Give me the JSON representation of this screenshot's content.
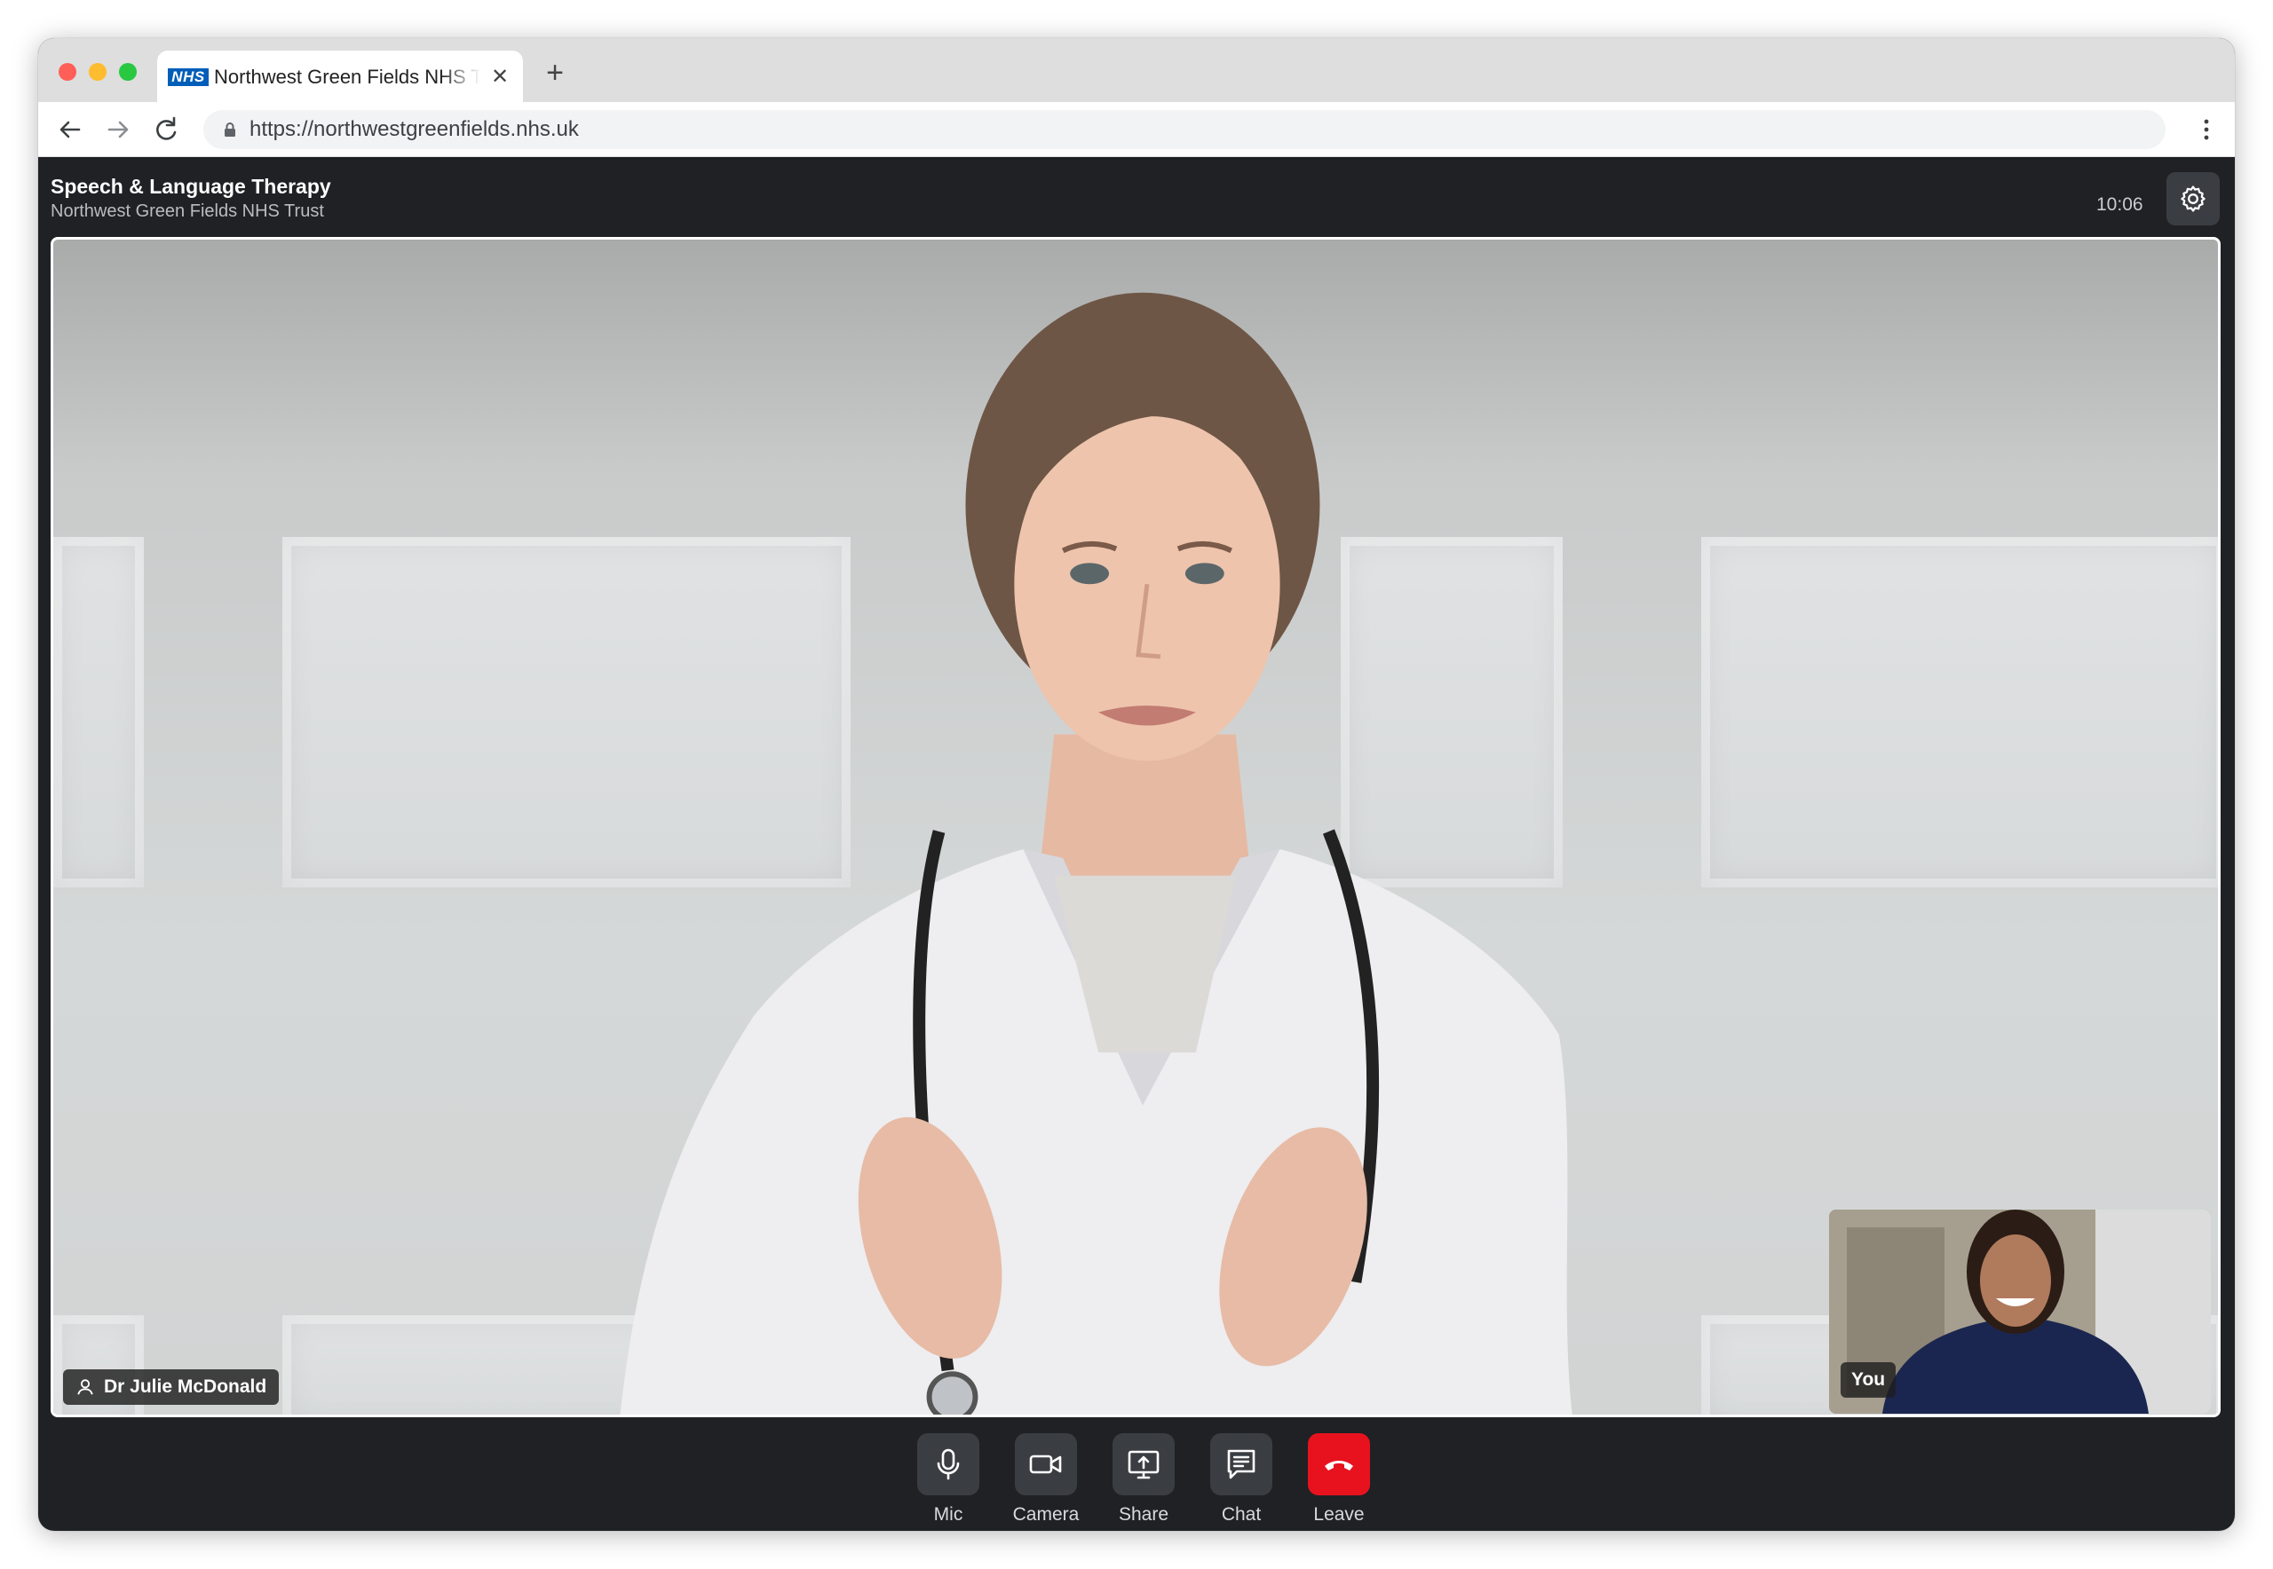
{
  "browser": {
    "tab_title": "Northwest Green Fields NHS Trust",
    "tab_logo": "NHS",
    "close_glyph": "✕",
    "new_tab_glyph": "+",
    "url": "https://northwestgreenfields.nhs.uk"
  },
  "app": {
    "title": "Speech & Language Therapy",
    "subtitle": "Northwest Green Fields NHS Trust",
    "time": "10:06"
  },
  "call": {
    "remote_name": "Dr Julie McDonald",
    "self_label": "You"
  },
  "controls": {
    "mic": "Mic",
    "camera": "Camera",
    "share": "Share",
    "chat": "Chat",
    "leave": "Leave"
  },
  "colors": {
    "leave_red": "#e8121f",
    "nhs_blue": "#005eb8",
    "app_background": "#1f2124"
  }
}
